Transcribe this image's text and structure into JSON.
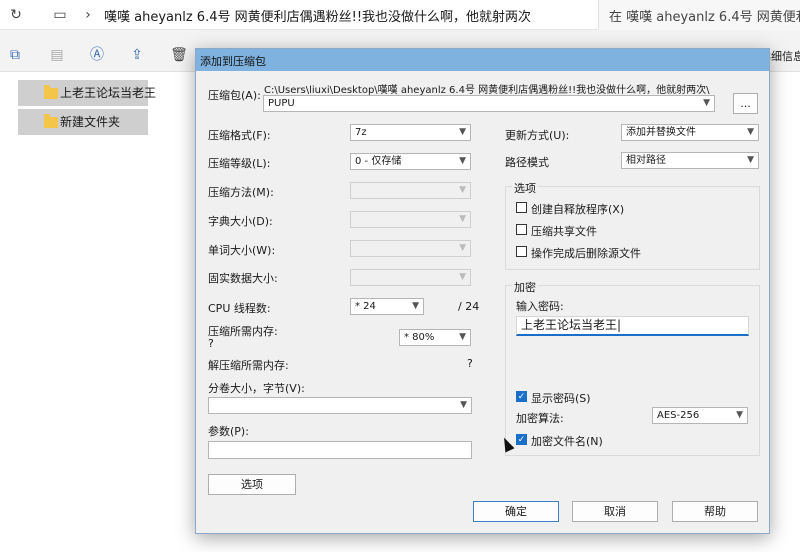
{
  "explorer": {
    "address": "嘆嘆 aheyanlz 6.4号 网黄便利店偶遇粉丝!!我也没做什么啊，他就射两次",
    "search_text": "在 嘆嘆 aheyanlz 6.4号 网黄便利",
    "detail_label": "详细信息",
    "files": [
      {
        "name": "上老王论坛当老王"
      },
      {
        "name": "新建文件夹"
      }
    ]
  },
  "dialog": {
    "title": "添加到压缩包",
    "archive_label": "压缩包(A):",
    "archive_path": "C:\\Users\\liuxi\\Desktop\\嘆嘆 aheyanlz 6.4号 网黄便利店偶遇粉丝!!我也没做什么啊，他就射两次\\",
    "archive_name": "PUPU",
    "browse_label": "...",
    "format_label": "压缩格式(F):",
    "format_value": "7z",
    "level_label": "压缩等级(L):",
    "level_value": "0 - 仅存储",
    "method_label": "压缩方法(M):",
    "dict_label": "字典大小(D):",
    "word_label": "单词大小(W):",
    "solid_label": "固实数据大小:",
    "cpu_label": "CPU 线程数:",
    "cpu_value": "* 24",
    "cpu_total": "/ 24",
    "mem_comp_label": "压缩所需内存:",
    "mem_comp_q": "?",
    "mem_comp_value": "* 80%",
    "mem_decomp_label": "解压缩所需内存:",
    "mem_decomp_q": "?",
    "split_label": "分卷大小，字节(V):",
    "params_label": "参数(P):",
    "options_button": "选项",
    "update_label": "更新方式(U):",
    "update_value": "添加并替换文件",
    "path_label": "路径模式",
    "path_value": "相对路径",
    "options_group": "选项",
    "opt_sfx": "创建自释放程序(X)",
    "opt_shared": "压缩共享文件",
    "opt_delete": "操作完成后删除源文件",
    "enc_group": "加密",
    "enc_pwd_label": "输入密码:",
    "enc_pwd_value": "上老王论坛当老王|",
    "enc_show": "显示密码(S)",
    "enc_method_label": "加密算法:",
    "enc_method_value": "AES-256",
    "enc_names": "加密文件名(N)",
    "ok_button": "确定",
    "cancel_button": "取消",
    "help_button": "帮助"
  }
}
